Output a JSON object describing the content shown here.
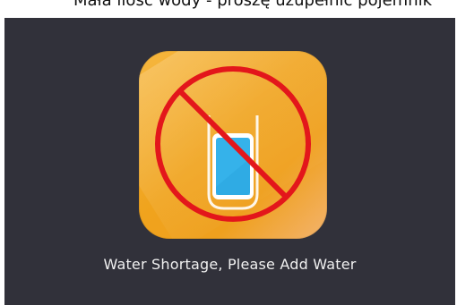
{
  "header": {
    "caption": "Mała ilość wody - proszę uzupełnić pojemnik"
  },
  "screen": {
    "message": "Water Shortage, Please Add Water",
    "colors": {
      "background": "#31313a",
      "icon_orange": "#f0a31d",
      "warning_red": "#e3161b",
      "water_blue": "#35b2ea"
    },
    "icons": {
      "app": "water-tank-icon",
      "warning": "warning-ring-icon"
    }
  }
}
